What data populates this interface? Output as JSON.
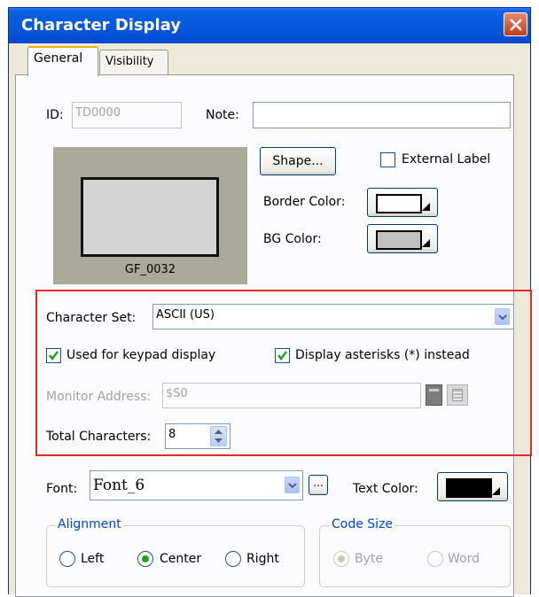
{
  "window": {
    "title": "Character Display"
  },
  "tabs": [
    {
      "label": "General",
      "active": true
    },
    {
      "label": "Visibility",
      "active": false
    }
  ],
  "id_field": {
    "label": "ID:",
    "value": "TD0000"
  },
  "note_field": {
    "label": "Note:",
    "value": ""
  },
  "preview": {
    "shape_name": "GF_0032"
  },
  "shape_button": {
    "label": "Shape..."
  },
  "external_label": {
    "label": "External Label",
    "checked": false
  },
  "border_color": {
    "label": "Border Color:",
    "color": "#ffffff"
  },
  "bg_color": {
    "label": "BG Color:",
    "color": "#c0c0c0"
  },
  "character_set": {
    "label": "Character Set:",
    "value": "ASCII (US)"
  },
  "keypad_display": {
    "label": "Used for keypad display",
    "checked": true
  },
  "display_asterisks": {
    "label": "Display asterisks (*) instead",
    "checked": true
  },
  "monitor_address": {
    "label": "Monitor Address:",
    "value": "$S0"
  },
  "total_characters": {
    "label": "Total Characters:",
    "value": "8"
  },
  "font": {
    "label": "Font:",
    "value": "Font_6",
    "browse_label": "..."
  },
  "text_color": {
    "label": "Text Color:",
    "color": "#000000"
  },
  "alignment": {
    "legend": "Alignment",
    "options": [
      {
        "label": "Left",
        "selected": false
      },
      {
        "label": "Center",
        "selected": true
      },
      {
        "label": "Right",
        "selected": false
      }
    ]
  },
  "code_size": {
    "legend": "Code Size",
    "options": [
      {
        "label": "Byte",
        "selected": true
      },
      {
        "label": "Word",
        "selected": false
      }
    ]
  },
  "colors": {
    "titlebar": "#0658dd",
    "highlight": "#e32a2a",
    "window_bg": "#ece9d8",
    "group_legend": "#0046d5"
  }
}
